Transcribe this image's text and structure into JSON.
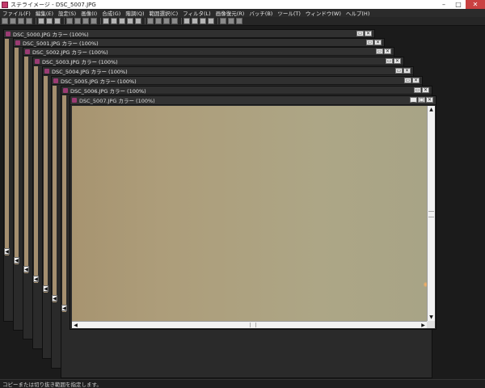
{
  "app": {
    "title": "ステライメージ - DSC_5007.JPG",
    "window_controls": [
      "–",
      "□",
      "✕"
    ]
  },
  "menu": [
    "ファイル(F)",
    "編集(E)",
    "設定(S)",
    "画像(I)",
    "合成(G)",
    "階調(Q)",
    "範囲選択(C)",
    "フィルタ(L)",
    "画像復元(R)",
    "バッチ(B)",
    "ツール(T)",
    "ウィンドウ(W)",
    "ヘルプ(H)"
  ],
  "documents": [
    {
      "label": "DSC_5000.JPG カラー (100%)"
    },
    {
      "label": "DSC_5001.JPG カラー (100%)"
    },
    {
      "label": "DSC_5002.JPG カラー (100%)"
    },
    {
      "label": "DSC_5003.JPG カラー (100%)"
    },
    {
      "label": "DSC_5004.JPG カラー (100%)"
    },
    {
      "label": "DSC_5005.JPG カラー (100%)"
    },
    {
      "label": "DSC_5006.JPG カラー (100%)"
    }
  ],
  "active_document": {
    "label": "DSC_5007.JPG カラー (100%)",
    "controls": [
      "_",
      "□",
      "✕"
    ]
  },
  "status": "コピーまたは切り抜き範囲を指定します。",
  "scroll_glyphs": {
    "up": "▲",
    "down": "▼",
    "left": "◀",
    "right": "▶"
  },
  "doc_controls": {
    "restore": "▭",
    "close": "✕",
    "minimize": "_"
  },
  "colors": {
    "accent": "#c43b6c",
    "image_tone": "#ada17f"
  }
}
